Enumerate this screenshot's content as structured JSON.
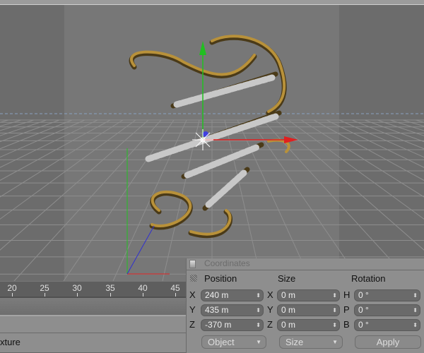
{
  "timeline": {
    "ticks": [
      "20",
      "25",
      "30",
      "35",
      "40",
      "45"
    ]
  },
  "bottom_tab": {
    "label": "xture"
  },
  "coordinates": {
    "title": "Coordinates",
    "headers": {
      "position": "Position",
      "size": "Size",
      "rotation": "Rotation"
    },
    "rows": [
      {
        "pos_axis": "X",
        "pos": "240 m",
        "size_axis": "X",
        "size": "0 m",
        "rot_axis": "H",
        "rot": "0 °"
      },
      {
        "pos_axis": "Y",
        "pos": "435 m",
        "size_axis": "Y",
        "size": "0 m",
        "rot_axis": "P",
        "rot": "0 °"
      },
      {
        "pos_axis": "Z",
        "pos": "-370 m",
        "size_axis": "Z",
        "size": "0 m",
        "rot_axis": "B",
        "rot": "0 °"
      }
    ],
    "mode_dropdown": "Object",
    "size_dropdown": "Size",
    "apply_button": "Apply"
  },
  "colors": {
    "x_axis": "#e02020",
    "y_axis": "#20c020",
    "z_axis": "#3030d0",
    "model_gold": "#a8822e"
  }
}
